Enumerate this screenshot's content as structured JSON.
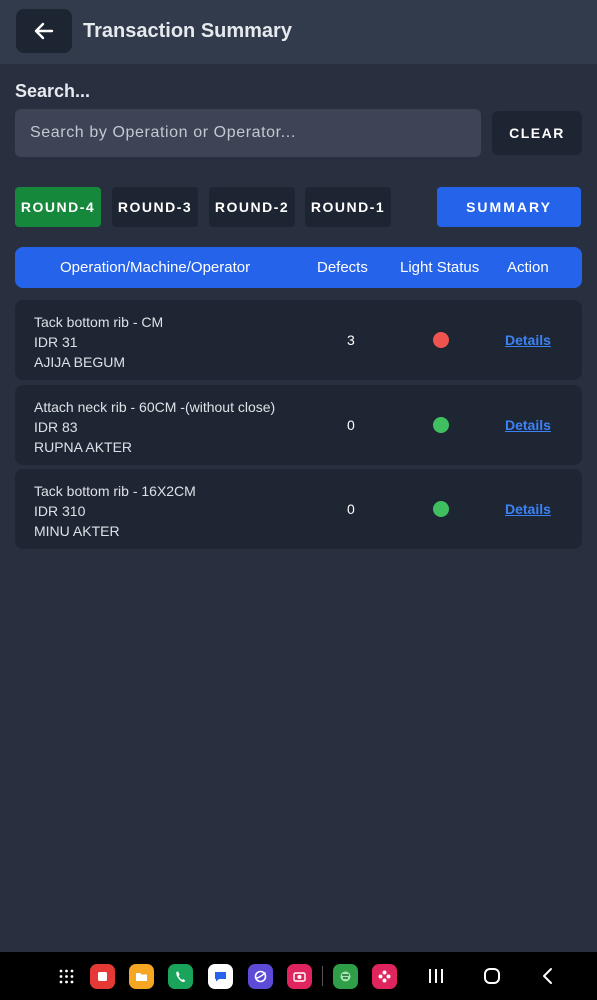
{
  "header": {
    "title": "Transaction Summary"
  },
  "search": {
    "label": "Search...",
    "placeholder": "Search by Operation or Operator...",
    "value": "",
    "clear_label": "CLEAR"
  },
  "rounds": [
    {
      "label": "ROUND-4",
      "active": true
    },
    {
      "label": "ROUND-3",
      "active": false
    },
    {
      "label": "ROUND-2",
      "active": false
    },
    {
      "label": "ROUND-1",
      "active": false
    }
  ],
  "summary_label": "SUMMARY",
  "table": {
    "columns": [
      "Operation/Machine/Operator",
      "Defects",
      "Light Status",
      "Action"
    ],
    "rows": [
      {
        "operation": "Tack bottom rib - CM",
        "machine": "IDR 31",
        "operator": "AJIJA  BEGUM",
        "defects": "3",
        "light": "red",
        "action": "Details"
      },
      {
        "operation": "Attach neck rib - 60CM -(without close)",
        "machine": "IDR 83",
        "operator": "RUPNA  AKTER",
        "defects": "0",
        "light": "green",
        "action": "Details"
      },
      {
        "operation": "Tack bottom rib - 16X2CM",
        "machine": "IDR 310",
        "operator": "MINU  AKTER",
        "defects": "0",
        "light": "green",
        "action": "Details"
      }
    ]
  },
  "colors": {
    "background": "#283040",
    "header": "#323b4b",
    "accent": "#2563eb",
    "active_round": "#15883c",
    "status_red": "#ef5350",
    "status_green": "#3fbf5f",
    "link": "#3b82f6"
  },
  "navbar": {
    "apps": [
      "apps-grid-icon",
      "notes-app-icon",
      "files-app-icon",
      "phone-app-icon",
      "messages-app-icon",
      "browser-app-icon",
      "camera-app-icon",
      "game-app-icon",
      "flower-app-icon"
    ],
    "system": [
      "recents-icon",
      "home-icon",
      "back-nav-icon"
    ]
  }
}
